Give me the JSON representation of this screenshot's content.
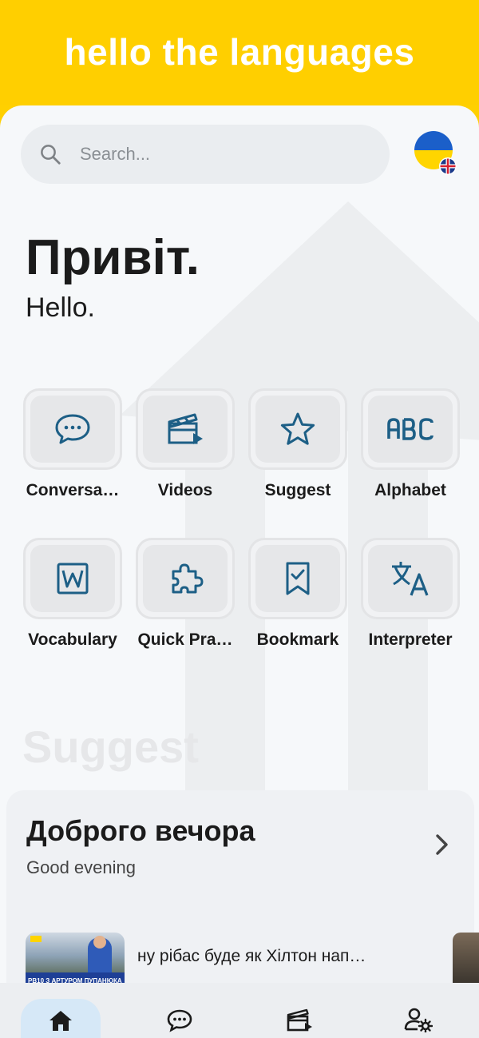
{
  "app": {
    "title": "hello the languages"
  },
  "search": {
    "placeholder": "Search..."
  },
  "language": {
    "primary_flag": "ukraine-flag",
    "secondary_flag": "uk-flag"
  },
  "greeting": {
    "native": "Привіт.",
    "translation": "Hello."
  },
  "features": [
    {
      "label": "Conversa…",
      "icon": "chat-bubble-icon"
    },
    {
      "label": "Videos",
      "icon": "clapperboard-icon"
    },
    {
      "label": "Suggest",
      "icon": "star-icon"
    },
    {
      "label": "Alphabet",
      "icon": "abc-icon"
    },
    {
      "label": "Vocabulary",
      "icon": "word-icon"
    },
    {
      "label": "Quick Pra…",
      "icon": "puzzle-icon"
    },
    {
      "label": "Bookmark",
      "icon": "bookmark-icon"
    },
    {
      "label": "Interpreter",
      "icon": "translate-icon"
    }
  ],
  "suggest": {
    "section_label": "Suggest",
    "card_title": "Доброго вечора",
    "card_subtitle": "Good evening",
    "video_title": "ну рібас буде як Хілтон нап…",
    "video_thumb_banner": "РВ10 З АРТУРОМ ПУПАНЮКА"
  },
  "bottom_nav": [
    {
      "icon": "home-icon",
      "active": true
    },
    {
      "icon": "chat-bubble-icon",
      "active": false
    },
    {
      "icon": "clapperboard-icon",
      "active": false
    },
    {
      "icon": "account-settings-icon",
      "active": false
    }
  ],
  "colors": {
    "accent": "#ffcf00",
    "icon": "#1d5f86",
    "nav_active": "#d6e8f7"
  }
}
